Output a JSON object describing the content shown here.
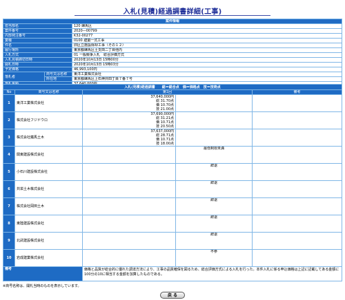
{
  "page": {
    "title": "入札(見積)経過調書詳細(工事)"
  },
  "info": {
    "header": "案件情報",
    "rows": [
      {
        "label": "担当部名",
        "value": "120 練馬区"
      },
      {
        "label": "案件番号",
        "value": "2020―00799"
      },
      {
        "label": "内部発注番号",
        "value": "K32-00277"
      },
      {
        "label": "業種",
        "value": "0100 建築一式工事"
      },
      {
        "label": "件名",
        "value": "旧区立施設除却工事（その１２）"
      },
      {
        "label": "履行場所",
        "value": "東京都練馬区土支田二丁目他内"
      },
      {
        "label": "入札方式",
        "value": "01 一般競争入札　総合評価方式"
      },
      {
        "label": "入札見積締切日時",
        "value": "2020年10月13日 15時00分"
      },
      {
        "label": "開札日時",
        "value": "2020年10月13日 15時03分"
      },
      {
        "label": "予定価格",
        "value": "46,993,100円"
      }
    ],
    "winner_label": "落札者",
    "winner_sub": [
      {
        "label": "商号又は名称",
        "value": "東洋工業株式会社"
      },
      {
        "label": "所在地",
        "value": "東京都練馬区上石神井四丁目７番７号"
      }
    ],
    "price_label": "落札金額",
    "price_value": "37,640,000円"
  },
  "results": {
    "header": "入札(見積)経過調書　　総＝総合点　価＝価格点　技＝技術点",
    "col_no": "No",
    "col_name": "商号又は名称",
    "col_round": "第1回",
    "col_remark": "備考",
    "rows": [
      {
        "no": "1",
        "name": "東洋工業株式会社",
        "lines": [
          "37,640,000円",
          "総 31.70点",
          "価 10.70点",
          "技 21.00点"
        ],
        "center": ""
      },
      {
        "no": "2",
        "name": "株式会社フジドウロ",
        "lines": [
          "37,690,000円",
          "総 31.21点",
          "価 10.71点",
          "技 20.50点"
        ],
        "center": ""
      },
      {
        "no": "3",
        "name": "株式会社鐵馬土木",
        "lines": [
          "37,637,000円",
          "総 28.71点",
          "価 10.71点",
          "技 18.00点"
        ],
        "center": ""
      },
      {
        "no": "4",
        "name": "関東建設株式会社",
        "lines": [],
        "center": "最低制限未満"
      },
      {
        "no": "5",
        "name": "小石川建設株式会社",
        "lines": [],
        "center": "辞退"
      },
      {
        "no": "6",
        "name": "共栄土木株式会社",
        "lines": [],
        "center": "辞退"
      },
      {
        "no": "7",
        "name": "株式会社岡田土木",
        "lines": [],
        "center": "辞退"
      },
      {
        "no": "8",
        "name": "東陸建設株式会社",
        "lines": [],
        "center": "辞退"
      },
      {
        "no": "9",
        "name": "北武建設株式会社",
        "lines": [],
        "center": "辞退"
      },
      {
        "no": "10",
        "name": "岩成建業株式会社",
        "lines": [],
        "center": "不参"
      }
    ],
    "biko_label": "備考",
    "biko_text": "価格と品質が総合的に優れた調達方法により、工事の品質確保を図るため、総合評価方式による入札を行った。本件入札に係る申込価格は上記に記載してある金額に100分の10に相当する金額を加算したものである。"
  },
  "note": "※商号名称は、開札当時のものを表示しています。",
  "buttons": {
    "back": "戻 る"
  }
}
